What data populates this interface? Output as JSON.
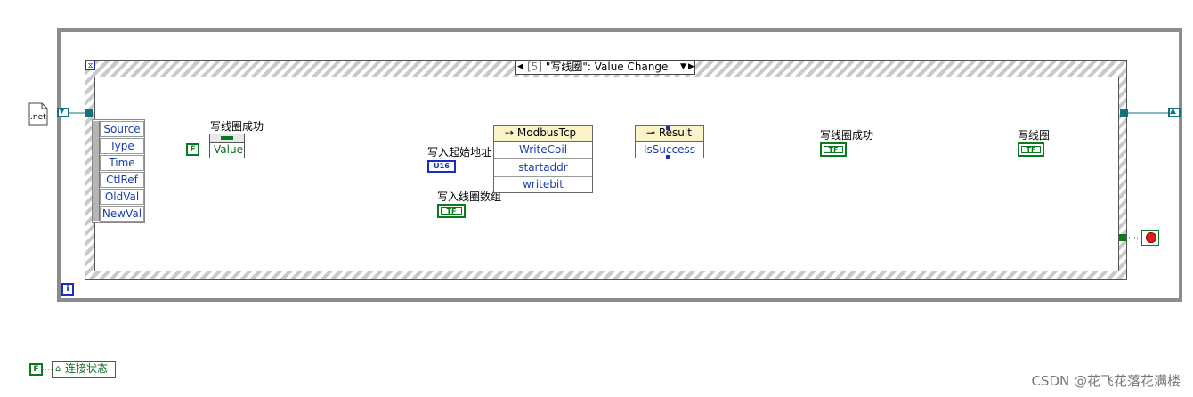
{
  "structure": {
    "event_case_selector": {
      "index": "[5]",
      "label": "\"写线圈\": Value Change"
    }
  },
  "event_data_node": {
    "items": [
      "Source",
      "Type",
      "Time",
      "CtlRef",
      "OldVal",
      "NewVal"
    ]
  },
  "controls": {
    "write_success_control": {
      "label": "写线圈成功",
      "property": "Value",
      "constant": "F"
    },
    "start_addr": {
      "label": "写入起始地址",
      "type": "U16"
    },
    "coil_array": {
      "label": "写入线圈数组",
      "type": "TF"
    }
  },
  "invoke_node": {
    "class": "ModbusTcp",
    "method": "WriteCoil",
    "params": [
      "startaddr",
      "writebit"
    ]
  },
  "unbundle_node": {
    "class": "Result",
    "field": "IsSuccess"
  },
  "indicators": {
    "success": {
      "label": "写线圈成功",
      "type": "TF"
    },
    "write_coil": {
      "label": "写线圈",
      "type": "TF"
    }
  },
  "outside": {
    "connection_constant": "F",
    "connection_property": "连接状态",
    "net_icon_label": ".net",
    "iteration_terminal": "i"
  },
  "watermark": "CSDN @花飞花落花满楼",
  "colors": {
    "refnum_wire": "#14737a",
    "boolean": "#0a7a1e",
    "integer": "#1a2dbf",
    "cluster_wire": "#b88a10"
  }
}
